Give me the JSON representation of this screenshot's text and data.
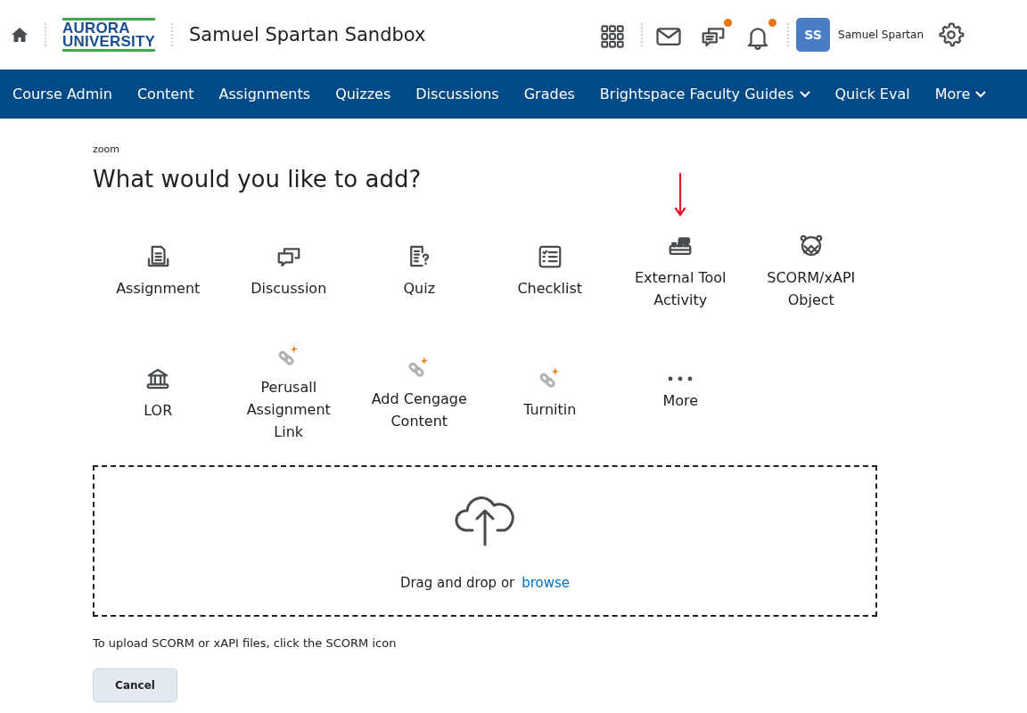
{
  "header": {
    "logo_lines": [
      "AURORA",
      "UNIVERSITY"
    ],
    "course_title": "Samuel Spartan Sandbox",
    "tools": [
      {
        "kind": "grid",
        "badge": false
      },
      {
        "kind": "mail",
        "badge": false
      },
      {
        "kind": "chat",
        "badge": true
      },
      {
        "kind": "bell",
        "badge": true
      }
    ],
    "user": {
      "initials": "SS",
      "name": "Samuel Spartan"
    }
  },
  "nav": [
    {
      "label": "Course Admin",
      "dropdown": false
    },
    {
      "label": "Content",
      "dropdown": false
    },
    {
      "label": "Assignments",
      "dropdown": false
    },
    {
      "label": "Quizzes",
      "dropdown": false
    },
    {
      "label": "Discussions",
      "dropdown": false
    },
    {
      "label": "Grades",
      "dropdown": false
    },
    {
      "label": "Brightspace Faculty Guides",
      "dropdown": true
    },
    {
      "label": "Quick Eval",
      "dropdown": false
    },
    {
      "label": "More",
      "dropdown": true
    }
  ],
  "breadcrumb": "zoom",
  "heading": "What would you like to add?",
  "items": [
    {
      "kind": "assignment",
      "label": "Assignment",
      "pointed": false
    },
    {
      "kind": "discussion",
      "label": "Discussion",
      "pointed": false
    },
    {
      "kind": "quiz",
      "label": "Quiz",
      "pointed": false
    },
    {
      "kind": "checklist",
      "label": "Checklist",
      "pointed": false
    },
    {
      "kind": "external",
      "label": "External Tool Activity",
      "pointed": true
    },
    {
      "kind": "scorm",
      "label": "SCORM/xAPI Object",
      "pointed": false
    },
    {
      "kind": "lor",
      "label": "LOR",
      "pointed": false
    },
    {
      "kind": "link",
      "label": "Perusall Assignment Link",
      "pointed": false
    },
    {
      "kind": "link",
      "label": "Add Cengage Content",
      "pointed": false
    },
    {
      "kind": "link",
      "label": "Turnitin",
      "pointed": false
    },
    {
      "kind": "more",
      "label": "More",
      "pointed": false
    }
  ],
  "dropzone": {
    "text": "Drag and drop or",
    "link": "browse"
  },
  "note": "To upload SCORM or xAPI files, click the SCORM icon",
  "cancel": "Cancel"
}
